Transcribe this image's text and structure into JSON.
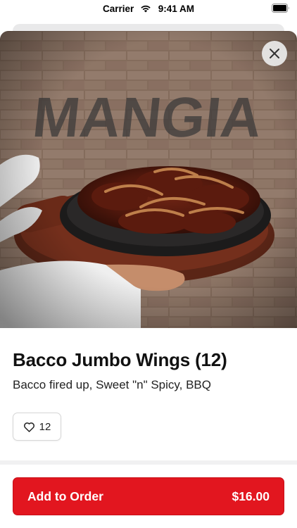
{
  "status_bar": {
    "carrier": "Carrier",
    "time": "9:41 AM",
    "icons": [
      "wifi-icon",
      "battery-icon"
    ]
  },
  "item": {
    "image_alt_icon": "food-photo",
    "title": "Bacco Jumbo Wings (12)",
    "description": "Bacco fired up, Sweet \"n\" Spicy, BBQ",
    "likes": "12",
    "like_icon": "heart-outline-icon",
    "close_icon": "close-icon"
  },
  "order_button": {
    "label": "Add to Order",
    "price": "$16.00"
  },
  "colors": {
    "accent": "#e2161f",
    "divider": "#f1f1f2"
  }
}
